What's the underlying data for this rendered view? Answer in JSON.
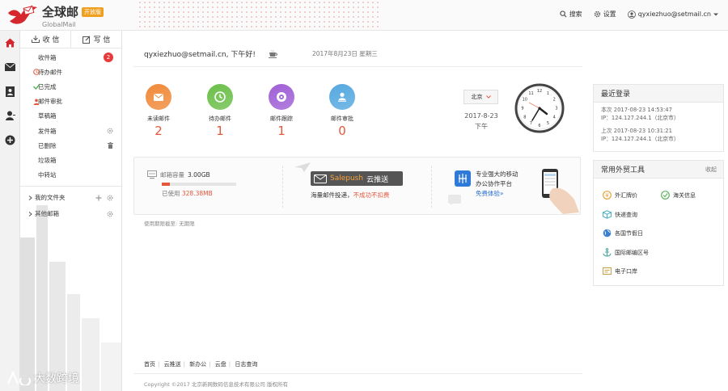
{
  "brand": {
    "name_cn": "全球邮",
    "name_en": "GlobalMail",
    "beta_label": "开放版",
    "accent_color": "#e4573b"
  },
  "topbar": {
    "search": "搜索",
    "settings": "设置",
    "user": "qyxiezhuo@setmail.cn"
  },
  "rail": {
    "icons": [
      "home-icon",
      "mail-icon",
      "contacts-icon",
      "user-icon",
      "apps-icon"
    ]
  },
  "panel": {
    "receive": "收 信",
    "compose": "写 信",
    "folders": [
      {
        "label": "收件箱",
        "badge": "2"
      },
      {
        "label": "待办邮件"
      },
      {
        "label": "已完成"
      },
      {
        "label": "邮件审批"
      },
      {
        "label": "草稿箱"
      },
      {
        "label": "发件箱"
      },
      {
        "label": "已删除"
      },
      {
        "label": "垃圾箱"
      },
      {
        "label": "中转站"
      }
    ],
    "groups": [
      {
        "label": "我的文件夹"
      },
      {
        "label": "其他邮箱"
      }
    ]
  },
  "main": {
    "greeting": "qyxiezhuo@setmail.cn, 下午好!",
    "date": "2017年8月23日 星期三",
    "stats": [
      {
        "label": "未读邮件",
        "value": "2",
        "color": "#f08a3a",
        "icon": "envelope-icon"
      },
      {
        "label": "待办邮件",
        "value": "1",
        "color": "#6bbf4a",
        "icon": "clock-icon"
      },
      {
        "label": "邮件跟踪",
        "value": "1",
        "color": "#a05fd6",
        "icon": "target-icon"
      },
      {
        "label": "邮件审批",
        "value": "0",
        "color": "#55a8e0",
        "icon": "approve-icon"
      }
    ],
    "clock": {
      "city": "北京",
      "date": "2017-8-23",
      "period": "下午"
    },
    "storage": {
      "capacity_label": "邮箱容量",
      "capacity": "3.00GB",
      "used_label": "已使用",
      "used": "328.38MB",
      "used_fraction": 0.107
    },
    "salepush": {
      "brand": "Salepush",
      "name": "云推送",
      "desc_a": "海量邮件投递，",
      "desc_b": "不成功不扣费"
    },
    "platform": {
      "line1": "专业强大的移动",
      "line2": "办公协作平台",
      "link": "免费体验»"
    },
    "expire": "使用期限截至: 无期限"
  },
  "recent_login": {
    "title": "最近登录",
    "entries": [
      {
        "time": "本次 2017-08-23 14:53:47",
        "ip": "IP：124.127.244.1（北京市）"
      },
      {
        "time": "上次 2017-08-23 10:31:21",
        "ip": "IP：124.127.244.1（北京市）"
      }
    ]
  },
  "tools": {
    "title": "常用外贸工具",
    "collapse": "收起",
    "items": [
      {
        "label": "外汇牌价",
        "icon": "exchange-icon",
        "color": "#e8a23a"
      },
      {
        "label": "海关信息",
        "icon": "customs-icon",
        "color": "#5fb35f"
      },
      {
        "label": "快递查询",
        "icon": "express-icon",
        "color": "#4ab0c4"
      },
      {
        "label": "各国节假日",
        "icon": "globe-icon",
        "color": "#3a7fd0"
      },
      {
        "label": "国际邮编区号",
        "icon": "anchor-icon",
        "color": "#4aa39a"
      },
      {
        "label": "电子口岸",
        "icon": "port-icon",
        "color": "#c9a24a"
      }
    ]
  },
  "footer": {
    "links": [
      "首页",
      "云推送",
      "新办公",
      "云盘",
      "日志查询"
    ],
    "copyright": "Copyright ©2017 北京新网数码信息技术有限公司 版权所有"
  },
  "watermark": "大数跨境"
}
